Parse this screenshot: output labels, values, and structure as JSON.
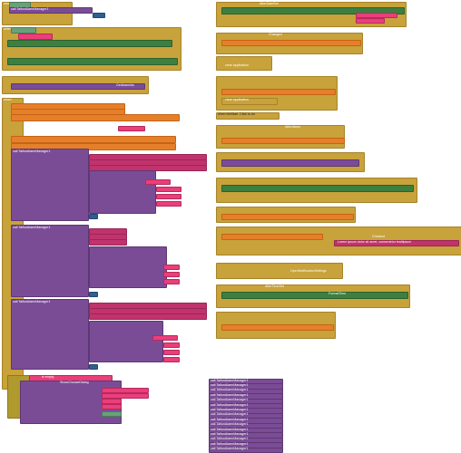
{
  "workspace": {
    "event_word": "when",
    "do_word": "do",
    "call_word": "call",
    "set_word": "set",
    "to_word": "to",
    "block_click": "Click",
    "after_datetime": "AfterDateSet",
    "after_timeset": "AfterTimeSet",
    "after_alarm": "AfterAlarm",
    "started": "Started",
    "changed": "Changed",
    "checked": "Checked",
    "get_word": "get",
    "result_word": "result",
    "successful_word": "successful",
    "string_literal": "Lorem ipsum dolor sit amet, consectetur tealtipsum",
    "clear_app": "clear application",
    "open_notification": "OpenNotificationSettings",
    "get_alarm_ids": "GetAlarmIds",
    "format_date": "FormatDate",
    "format_time": "FormatTime",
    "set_alarm": "SetAlarm",
    "show_choose": "ShowChooseDialog",
    "get_plain_start_text": "get plain start text",
    "is_empty": "is empty",
    "when_click_clock": "when btnStart .Click to do",
    "alarm_manager_repeat": "call TaifunAlarmManager1"
  },
  "sample_labels": {
    "text_row": "To exeque 2 Dunnuq. en aeuq.. Jaw, never fit in aimajjo....",
    "initial_text": "initial",
    "title_text": "title",
    "startText": "startText",
    "interval_text": "interval",
    "id_text": "id",
    "when_text": "when",
    "text_text": "text",
    "inter_num": "0",
    "num_one": "1",
    "num_two": "2"
  },
  "repeated_calls": [
    "call TaifunAlarmManager1",
    "call TaifunAlarmManager1",
    "call TaifunAlarmManager1",
    "call TaifunAlarmManager1",
    "call TaifunAlarmManager1",
    "call TaifunAlarmManager1",
    "call TaifunAlarmManager1",
    "call TaifunAlarmManager1",
    "call TaifunAlarmManager1",
    "call TaifunAlarmManager1",
    "call TaifunAlarmManager1",
    "call TaifunAlarmManager1",
    "call TaifunAlarmManager1",
    "call TaifunAlarmManager1",
    "call TaifunAlarmManager1"
  ]
}
